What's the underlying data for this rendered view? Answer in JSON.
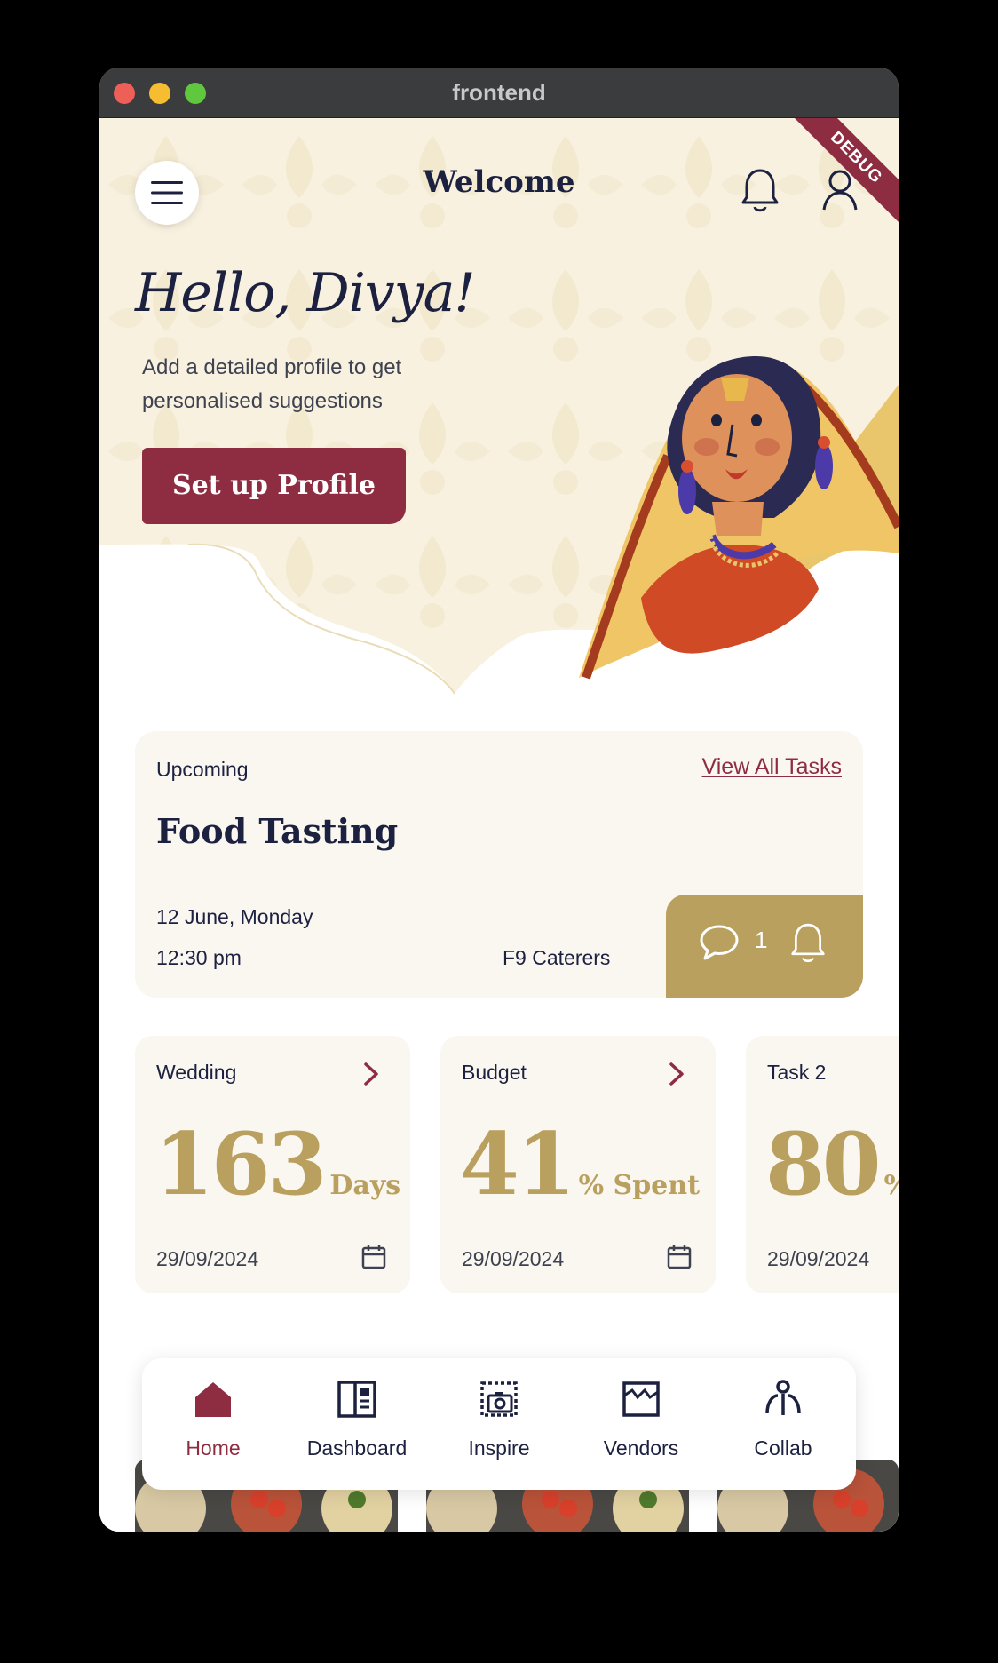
{
  "window": {
    "title": "frontend"
  },
  "header": {
    "title": "Welcome",
    "debug_banner": "DEBUG"
  },
  "hero": {
    "greeting": "Hello, Divya!",
    "subtitle": "Add a detailed profile to get personalised suggestions",
    "cta_label": "Set up Profile"
  },
  "upcoming": {
    "label": "Upcoming",
    "link": "View All Tasks",
    "title": "Food Tasting",
    "date": "12 June, Monday",
    "time": "12:30 pm",
    "vendor": "F9 Caterers",
    "comment_count": "1"
  },
  "stats": [
    {
      "label": "Wedding",
      "value": "163",
      "unit": "Days",
      "date": "29/09/2024"
    },
    {
      "label": "Budget",
      "value": "41",
      "unit": "% Spent",
      "date": "29/09/2024"
    },
    {
      "label": "Task 2",
      "value": "80",
      "unit": "%",
      "date": "29/09/2024"
    }
  ],
  "nav": {
    "items": [
      {
        "label": "Home",
        "icon": "home-icon",
        "active": true
      },
      {
        "label": "Dashboard",
        "icon": "dashboard-icon"
      },
      {
        "label": "Inspire",
        "icon": "inspire-icon"
      },
      {
        "label": "Vendors",
        "icon": "vendors-icon"
      },
      {
        "label": "Collab",
        "icon": "collab-icon"
      }
    ]
  },
  "colors": {
    "brand": "#8e2d42",
    "gold": "#b9a05f",
    "navy": "#1c2140",
    "card": "#faf6f0",
    "hero_bg": "#f8f1e0"
  }
}
